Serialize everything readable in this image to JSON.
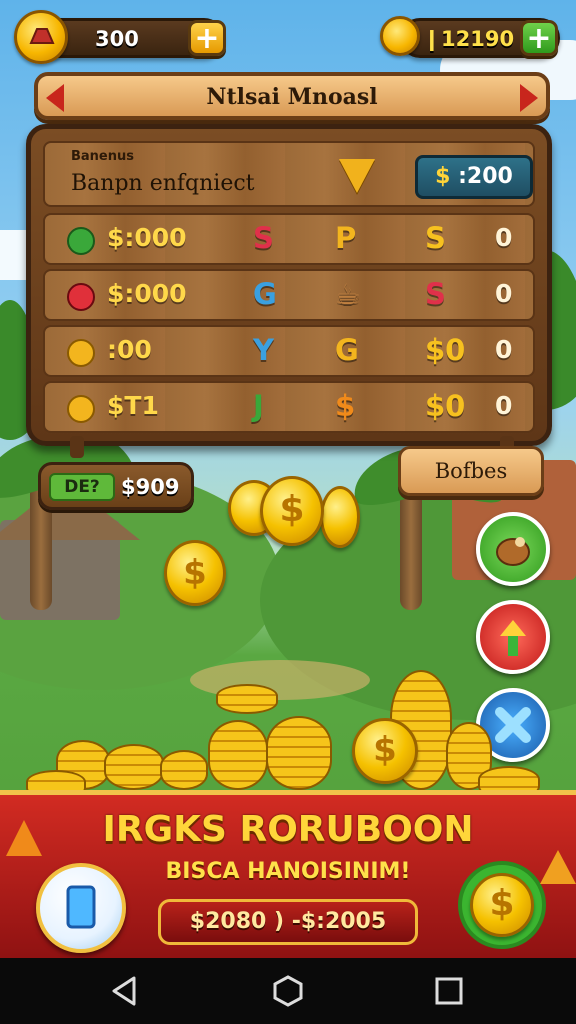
{
  "top_bar": {
    "coins_value": "300",
    "gold_value": "12190",
    "gold_prefix": "❙",
    "plus_label": "+"
  },
  "banner": {
    "title": "Ntlsai Mnoasl"
  },
  "board": {
    "header_small": "Banenus",
    "header_main": "Banpn enfqniect",
    "price_symbol": "$",
    "price_value": ":200",
    "rows": [
      {
        "amount": "$:000",
        "glyph1": "S",
        "glyph2": "P",
        "glyph3": "S",
        "count": "0"
      },
      {
        "amount": "$:000",
        "glyph1": "G",
        "glyph2": "☕",
        "glyph3": "S",
        "count": "0"
      },
      {
        "amount": ":00",
        "glyph1": "Y",
        "glyph2": "G",
        "glyph3": "$0",
        "count": "0"
      },
      {
        "amount": "$T1",
        "glyph1": "J",
        "glyph2": "$",
        "glyph3": "$0",
        "count": "0"
      }
    ]
  },
  "bonus_left": {
    "tag": "DE?",
    "value": "$909"
  },
  "bonuses_button": "Bofbes",
  "promo": {
    "title": "IRGKS RORUBOON",
    "subtitle": "BISCA HANOISINIM!",
    "price": "$2080 ) -$:2005"
  },
  "coin_symbol": "$",
  "colors": {
    "accent_gold": "#f5c100",
    "banner_red": "#d22b22",
    "wood": "#9c6a38"
  }
}
